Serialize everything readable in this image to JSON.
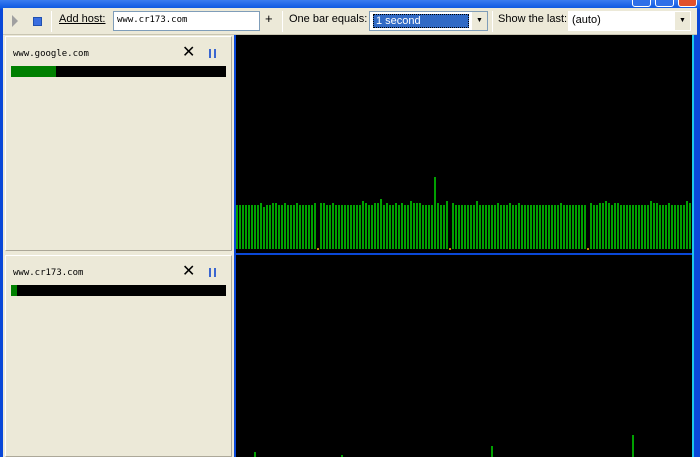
{
  "toolbar": {
    "add_host_label": "Add host:",
    "host_input": "www.cr173.com",
    "add_label": "+",
    "bar_label": "One bar equals:",
    "bar_value": "1 second",
    "show_label": "Show the last:",
    "show_value": "(auto)"
  },
  "hosts": [
    {
      "name": "www.google.com",
      "progress": 0.21
    },
    {
      "name": "www.cr173.com",
      "progress": 0.03
    }
  ],
  "colors": {
    "bar": "#00a000",
    "background": "#000000",
    "panel": "#ece9d8"
  },
  "chart_data": [
    {
      "type": "bar",
      "title": "www.google.com",
      "values": [
        44,
        44,
        44,
        44,
        44,
        44,
        44,
        44,
        46,
        42,
        44,
        44,
        46,
        46,
        44,
        44,
        46,
        44,
        44,
        44,
        46,
        44,
        44,
        44,
        44,
        44,
        46,
        null,
        46,
        46,
        44,
        44,
        46,
        44,
        44,
        44,
        44,
        44,
        44,
        44,
        44,
        44,
        48,
        46,
        44,
        44,
        46,
        46,
        50,
        44,
        46,
        44,
        44,
        46,
        44,
        46,
        44,
        44,
        48,
        46,
        46,
        46,
        44,
        44,
        44,
        44,
        72,
        46,
        44,
        44,
        48,
        null,
        46,
        44,
        44,
        44,
        44,
        44,
        44,
        44,
        48,
        44,
        44,
        44,
        44,
        44,
        44,
        46,
        44,
        44,
        44,
        46,
        44,
        44,
        46,
        44,
        44,
        44,
        44,
        44,
        44,
        44,
        44,
        44,
        44,
        44,
        44,
        44,
        46,
        44,
        44,
        44,
        44,
        44,
        44,
        44,
        44,
        null,
        46,
        44,
        44,
        46,
        46,
        48,
        46,
        44,
        46,
        46,
        44,
        44,
        44,
        44,
        44,
        44,
        44,
        44,
        44,
        44,
        48,
        46,
        46,
        44,
        44,
        44,
        46,
        44,
        44,
        44,
        44,
        44,
        48,
        46,
        44,
        44
      ]
    },
    {
      "type": "bar",
      "title": "www.cr173.com",
      "values": {
        "6": 18,
        "35": 15,
        "85": 24,
        "132": 35
      }
    }
  ]
}
